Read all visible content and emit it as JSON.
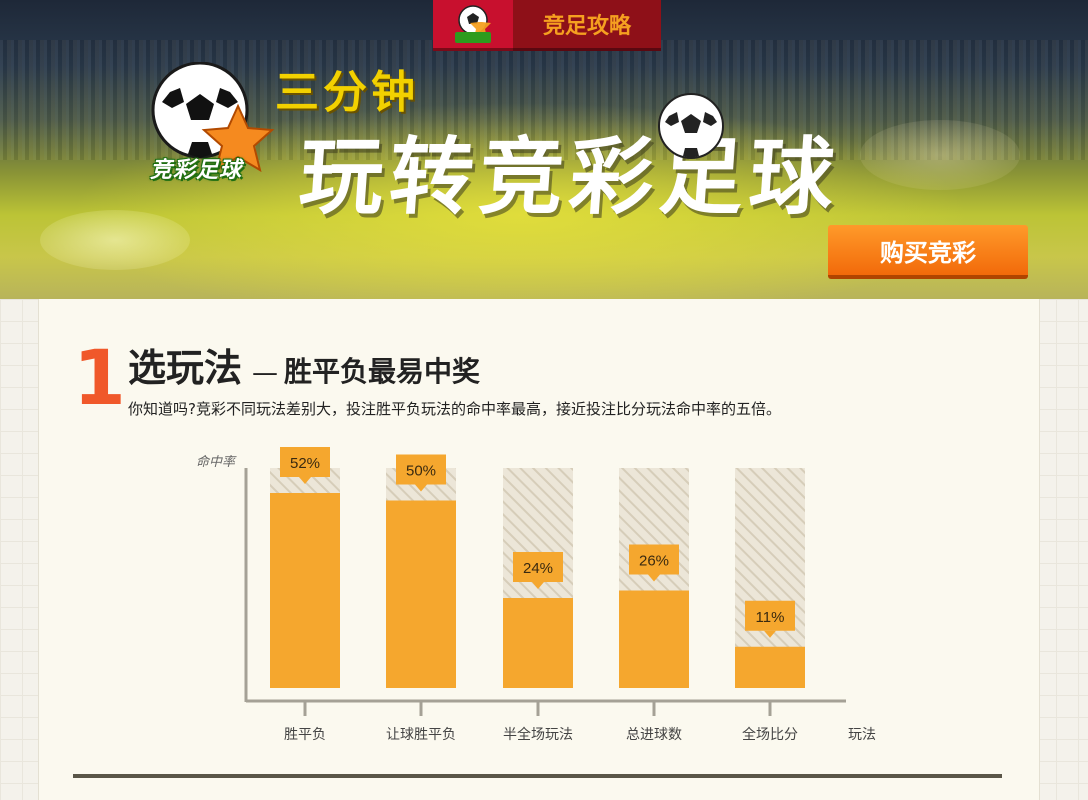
{
  "header": {
    "tab_label": "竞足攻略",
    "tab_logo_text": "竞彩足球",
    "brand_text": "竞彩足球",
    "subtitle": "三分钟",
    "title": "玩转竞彩足球",
    "buy_button": "购买竞彩"
  },
  "section": {
    "number": "1",
    "title": "选玩法",
    "dash": "—",
    "subtitle": "胜平负最易中奖",
    "description": "你知道吗?竞彩不同玩法差别大，投注胜平负玩法的命中率最高，接近投注比分玩法命中率的五倍。"
  },
  "chart_data": {
    "type": "bar",
    "title": "",
    "xlabel": "玩法",
    "ylabel": "命中率",
    "categories": [
      "胜平负",
      "让球胜平负",
      "半全场玩法",
      "总进球数",
      "全场比分"
    ],
    "values": [
      52,
      50,
      24,
      26,
      11
    ],
    "value_labels": [
      "52%",
      "50%",
      "24%",
      "26%",
      "11%"
    ],
    "unit": "%",
    "ylim": [
      0,
      100
    ],
    "grid": false,
    "colors": {
      "bar": "#f5a72e",
      "track": "#e9e3d4",
      "hatch": "#d9d1bf",
      "axis": "#a5a196"
    }
  }
}
